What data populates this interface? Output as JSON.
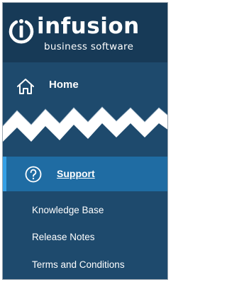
{
  "brand": {
    "name": "infusion",
    "tagline": "business software"
  },
  "nav": {
    "home_label": "Home",
    "support_label": "Support",
    "support_submenu": [
      {
        "label": "Knowledge Base"
      },
      {
        "label": "Release Notes"
      },
      {
        "label": "Terms and Conditions"
      }
    ]
  },
  "colors": {
    "sidebar_background": "#1e4a6d",
    "logo_background": "#173a57",
    "active_item_background": "#1f6ca3",
    "active_item_accent": "#35a0e6",
    "text": "#ffffff"
  },
  "icons": {
    "logo": "power-i-icon",
    "home": "home-icon",
    "support": "question-circle-icon"
  }
}
